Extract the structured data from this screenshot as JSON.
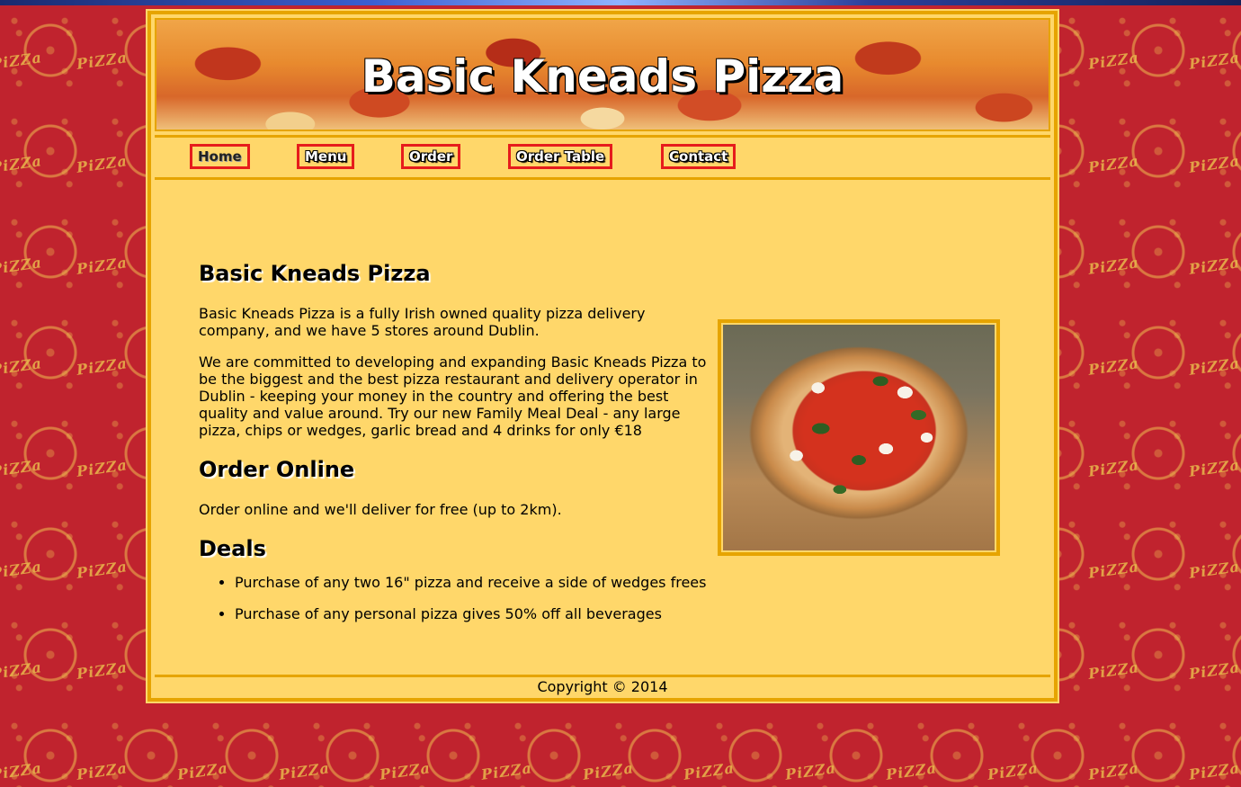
{
  "site": {
    "title": "Basic Kneads Pizza"
  },
  "nav": {
    "items": [
      {
        "label": "Home",
        "active": true
      },
      {
        "label": "Menu",
        "active": false
      },
      {
        "label": "Order",
        "active": false
      },
      {
        "label": "Order Table",
        "active": false
      },
      {
        "label": "Contact",
        "active": false
      }
    ]
  },
  "main": {
    "heading": "Basic Kneads Pizza",
    "intro": "Basic Kneads Pizza is a fully Irish owned quality pizza delivery company, and we have 5 stores around Dublin.",
    "about": "We are committed to developing and expanding Basic Kneads Pizza to be the biggest and the best pizza restaurant and delivery operator in Dublin - keeping your money in the country and offering the best quality and value around. Try our new Family Meal Deal - any large pizza, chips or wedges, garlic bread and 4 drinks for only €18",
    "order_heading": "Order Online",
    "order_text": "Order online and we'll deliver for free (up to 2km).",
    "deals_heading": "Deals",
    "deals": [
      "Purchase of any two 16\" pizza and receive a side of wedges frees",
      "Purchase of any personal pizza gives 50% off all beverages"
    ]
  },
  "footer": {
    "copyright": "Copyright © 2014"
  },
  "background": {
    "pattern_word": "PiZZa"
  },
  "colors": {
    "background_red": "#c0232e",
    "panel_yellow": "#ffd76a",
    "border_gold": "#e6a400",
    "nav_border_red": "#e61c1c"
  }
}
